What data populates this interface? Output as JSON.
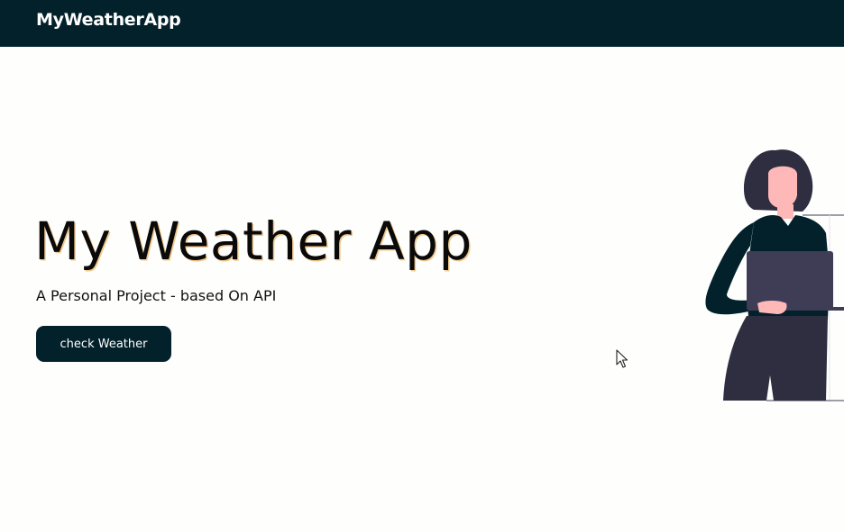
{
  "navbar": {
    "brand": "MyWeatherApp"
  },
  "hero": {
    "title": "My Weather App",
    "subtitle": "A Personal Project - based On API",
    "button_label": "check Weather"
  },
  "colors": {
    "nav_background": "#03212b",
    "button_background": "#03212b",
    "page_background": "#fefefd",
    "title_shadow": "#f2c98b",
    "figure_hair": "#2f2e41",
    "figure_skin": "#ffb8b8",
    "figure_top": "#03212b",
    "laptop": "#3f3d56"
  },
  "icons": {
    "illustration": "woman-holding-laptop-illustration",
    "cursor": "mouse-pointer-icon"
  }
}
